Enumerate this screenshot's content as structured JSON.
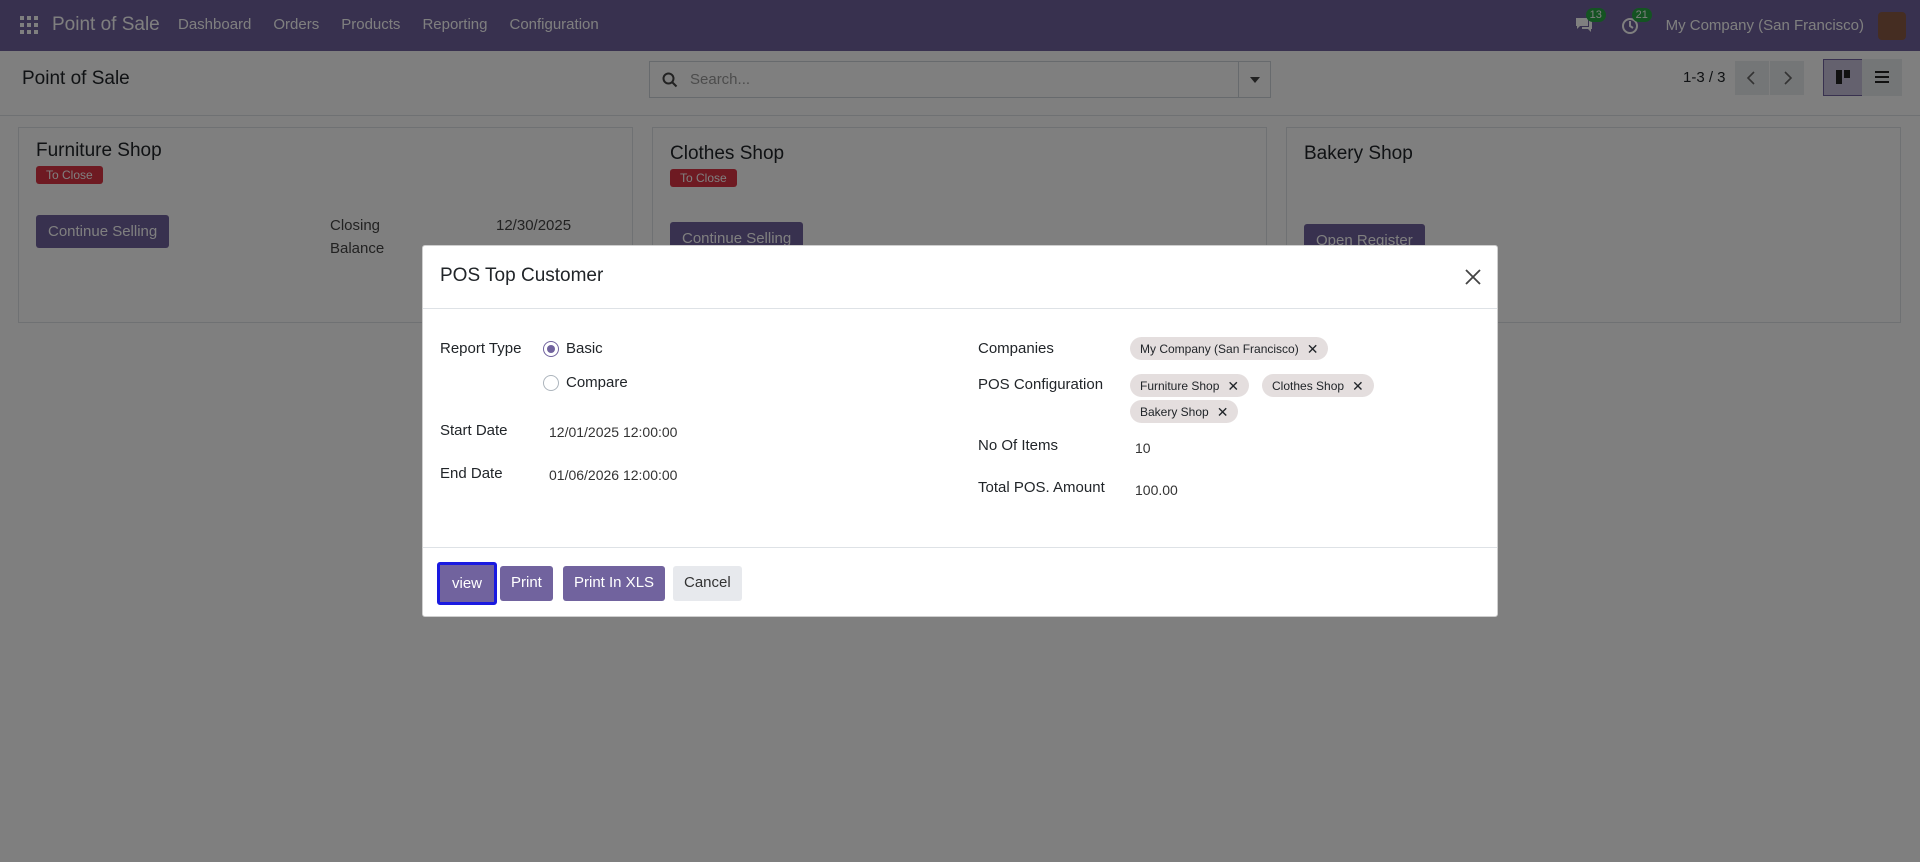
{
  "navbar": {
    "brand": "Point of Sale",
    "menu": [
      "Dashboard",
      "Orders",
      "Products",
      "Reporting",
      "Configuration"
    ],
    "messages_count": "13",
    "activities_count": "21",
    "company": "My Company (San Francisco)"
  },
  "control_panel": {
    "title": "Point of Sale",
    "search_placeholder": "Search...",
    "pager": "1-3 / 3"
  },
  "cards": [
    {
      "title": "Furniture Shop",
      "status": "To Close",
      "button": "Continue Selling",
      "closing_label": "Closing",
      "closing_value": "12/30/2025",
      "balance_label": "Balance"
    },
    {
      "title": "Clothes Shop",
      "status": "To Close",
      "button": "Continue Selling"
    },
    {
      "title": "Bakery Shop",
      "button": "Open Register"
    }
  ],
  "modal": {
    "title": "POS Top Customer",
    "report_type_label": "Report Type",
    "report_type_options": [
      "Basic",
      "Compare"
    ],
    "report_type_selected": "Basic",
    "start_date_label": "Start Date",
    "start_date_value": "12/01/2025 12:00:00",
    "end_date_label": "End Date",
    "end_date_value": "01/06/2026 12:00:00",
    "companies_label": "Companies",
    "companies": [
      "My Company (San Francisco)"
    ],
    "pos_config_label": "POS Configuration",
    "pos_configs": [
      "Furniture Shop",
      "Clothes Shop",
      "Bakery Shop"
    ],
    "no_of_items_label": "No Of Items",
    "no_of_items_value": "10",
    "total_amount_label": "Total POS. Amount",
    "total_amount_value": "100.00",
    "buttons": {
      "view": "view",
      "print": "Print",
      "print_xls": "Print In XLS",
      "cancel": "Cancel"
    },
    "remove_symbol": "✕"
  },
  "colors": {
    "brand": "#71639e",
    "danger": "#dc3545",
    "badge": "#28a745",
    "focus_ring": "#1a1ae0"
  }
}
